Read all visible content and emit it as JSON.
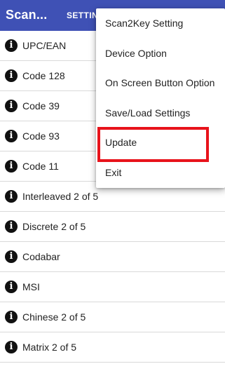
{
  "app": {
    "title": "Scan...",
    "tab_label": "SETTIN"
  },
  "list": {
    "icon": "info-icon",
    "items": [
      {
        "label": "UPC/EAN"
      },
      {
        "label": "Code 128"
      },
      {
        "label": "Code 39"
      },
      {
        "label": "Code 93"
      },
      {
        "label": "Code 11"
      },
      {
        "label": "Interleaved 2 of 5"
      },
      {
        "label": "Discrete 2 of 5"
      },
      {
        "label": "Codabar"
      },
      {
        "label": "MSI"
      },
      {
        "label": "Chinese 2 of 5"
      },
      {
        "label": "Matrix 2 of 5"
      }
    ]
  },
  "menu": {
    "items": [
      {
        "label": "Scan2Key Setting"
      },
      {
        "label": "Device Option"
      },
      {
        "label": "On Screen Button Option"
      },
      {
        "label": "Save/Load Settings"
      },
      {
        "label": "Update"
      },
      {
        "label": "Exit"
      }
    ]
  },
  "colors": {
    "appbar": "#3f51b5",
    "highlight": "#e8131b"
  }
}
